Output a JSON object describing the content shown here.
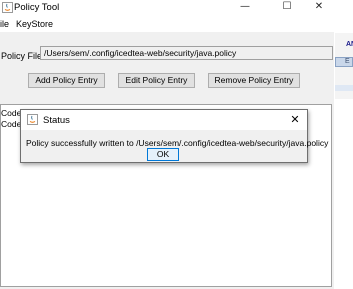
{
  "window": {
    "title": "Policy Tool"
  },
  "menu": [
    {
      "label": "ile"
    },
    {
      "label": "KeyStore"
    }
  ],
  "policy_file": {
    "label": "Policy File:",
    "value": "/Users/sem/.config/icedtea-web/security/java.policy"
  },
  "buttons": {
    "add": "Add Policy Entry",
    "edit": "Edit Policy Entry",
    "remove": "Remove Policy Entry"
  },
  "policy_entries": [
    {
      "label": "CodeB"
    },
    {
      "label": "CodeB"
    }
  ],
  "background_window": {
    "label_top": "AN",
    "label_field": "E"
  },
  "dialog": {
    "title": "Status",
    "message": "Policy successfully written to /Users/sem/.config/icedtea-web/security/java.policy",
    "ok_label": "OK"
  },
  "colors": {
    "accent": "#0078d7",
    "dialog_bg": "#f0f0f0",
    "button_bg": "#e1e1e1"
  }
}
